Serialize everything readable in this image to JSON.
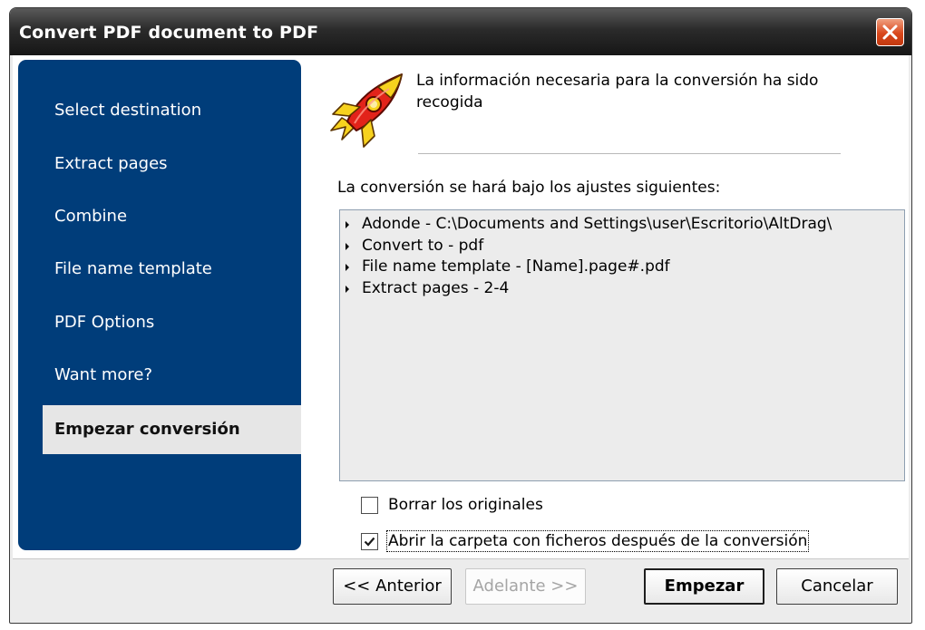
{
  "window": {
    "title": "Convert PDF document to PDF"
  },
  "sidebar": {
    "items": [
      {
        "label": "Select destination"
      },
      {
        "label": "Extract pages"
      },
      {
        "label": "Combine"
      },
      {
        "label": "File name template"
      },
      {
        "label": "PDF Options"
      },
      {
        "label": "Want more?"
      },
      {
        "label": "Empezar conversión",
        "active": true
      }
    ]
  },
  "main": {
    "icon": "rocket-icon",
    "info_text": "La información necesaria para la conversión ha sido recogida",
    "settings_label": "La conversión se hará bajo los ajustes siguientes:",
    "settings": [
      "Adonde - C:\\Documents and Settings\\user\\Escritorio\\AltDrag\\",
      "Convert to - pdf",
      "File name template - [Name].page#.pdf",
      "Extract pages - 2-4"
    ],
    "checkboxes": [
      {
        "label": "Borrar los originales",
        "checked": false
      },
      {
        "label": "Abrir la carpeta con ficheros después de la conversión",
        "checked": true
      }
    ]
  },
  "buttons": {
    "previous": "<< Anterior",
    "next": "Adelante >>",
    "start": "Empezar",
    "cancel": "Cancelar"
  }
}
